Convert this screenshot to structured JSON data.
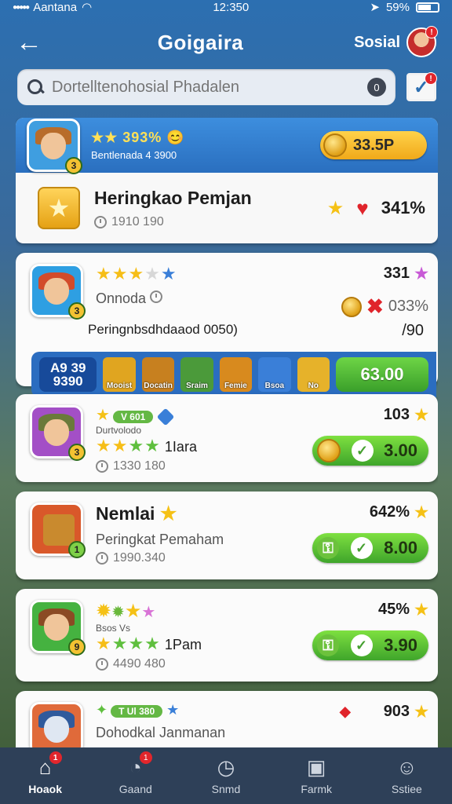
{
  "status_bar": {
    "carrier": "Aantana",
    "time": "12:350",
    "battery": "59%"
  },
  "header": {
    "back_label": "←",
    "title": "Goigaira",
    "social_label": "Sosial",
    "avatar_badge": "!"
  },
  "search": {
    "placeholder": "Dortelltenohosial Phadalen",
    "info_label": "0",
    "filter_badge": "!"
  },
  "top_card": {
    "stars_text": "★★ 393% 😊",
    "subtitle": "Bentlenada 4 3900",
    "level": "3",
    "coin_value": "33.5P",
    "title": "Heringkao Pemjan",
    "meta": "1910 190",
    "percent": "341%",
    "badge_level": "3"
  },
  "cards": [
    {
      "level": "3",
      "score": "331",
      "subtitle": "Onnoda",
      "percent": "033%",
      "strip_label": "Peringnbsdhdaaod 0050)",
      "strip_value": "/90",
      "strip_badge": "A9 39  9390",
      "items": [
        "Mooist",
        "Docatin",
        "Sraim",
        "Femie",
        "Bsoa",
        "No"
      ],
      "price": "63.00"
    },
    {
      "level": "3",
      "tag": "V 601",
      "sub1": "Durtvolodo",
      "stars_label": "1Iara",
      "meta": "1330 180",
      "score": "103",
      "price": "3.00"
    },
    {
      "level": "1",
      "title": "Nemlai",
      "subtitle": "Peringkat Pemaham",
      "meta": "1990.340",
      "score": "642%",
      "price": "8.00"
    },
    {
      "level": "9",
      "sub1": "Bsos Vs",
      "stars_label": "1Pam",
      "meta": "4490 480",
      "score": "45%",
      "price": "3.90"
    },
    {
      "tag": "T Ul 380",
      "subtitle": "Dohodkal Janmanan",
      "score": "903"
    }
  ],
  "nav": [
    {
      "label": "Hoaok",
      "icon": "home-icon",
      "badge": "1"
    },
    {
      "label": "Gaand",
      "icon": "chat-icon",
      "badge": "1"
    },
    {
      "label": "Snmd",
      "icon": "compass-icon",
      "badge": ""
    },
    {
      "label": "Farmk",
      "icon": "gift-icon",
      "badge": ""
    },
    {
      "label": "Sstiee",
      "icon": "profile-icon",
      "badge": ""
    }
  ],
  "colors": {
    "header_blue": "#2c6fb1",
    "accent_gold": "#f5c116",
    "accent_green": "#4cb531",
    "nav_bg": "#2e4058"
  }
}
